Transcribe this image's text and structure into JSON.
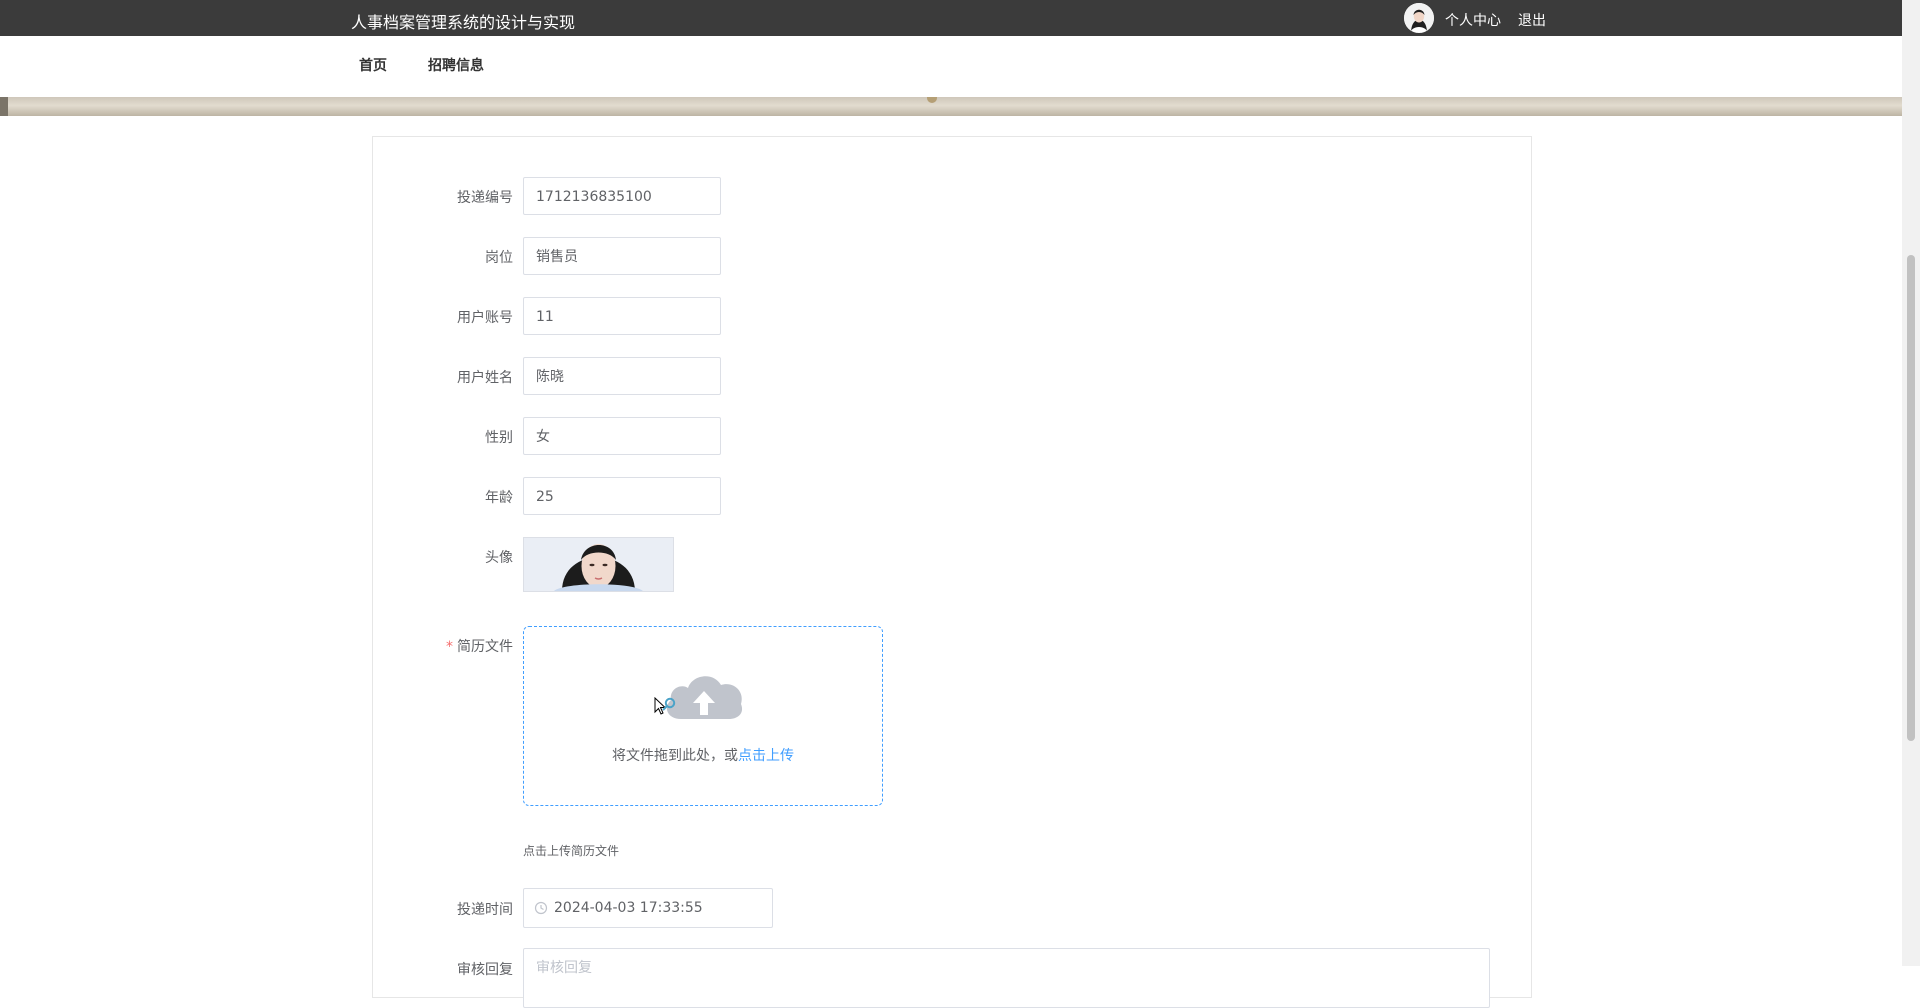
{
  "header": {
    "site_title": "人事档案管理系统的设计与实现",
    "user_center": "个人中心",
    "logout": "退出"
  },
  "nav": {
    "items": [
      {
        "label": "首页"
      },
      {
        "label": "招聘信息"
      }
    ]
  },
  "form": {
    "delivery_no": {
      "label": "投递编号",
      "value": "1712136835100"
    },
    "position": {
      "label": "岗位",
      "value": "销售员"
    },
    "account": {
      "label": "用户账号",
      "value": "11"
    },
    "name": {
      "label": "用户姓名",
      "value": "陈晓"
    },
    "gender": {
      "label": "性别",
      "value": "女"
    },
    "age": {
      "label": "年龄",
      "value": "25"
    },
    "avatar": {
      "label": "头像"
    },
    "resume": {
      "required_mark": "*",
      "label": "简历文件",
      "drop_text": "将文件拖到此处，或",
      "click_text": "点击上传",
      "tip": "点击上传简历文件"
    },
    "delivery_time": {
      "label": "投递时间",
      "value": "2024-04-03 17:33:55"
    },
    "review_reply": {
      "label": "审核回复",
      "placeholder": "审核回复"
    }
  },
  "colors": {
    "topbar": "#3b3b3b",
    "accent": "#409eff",
    "required": "#f56c6c"
  }
}
